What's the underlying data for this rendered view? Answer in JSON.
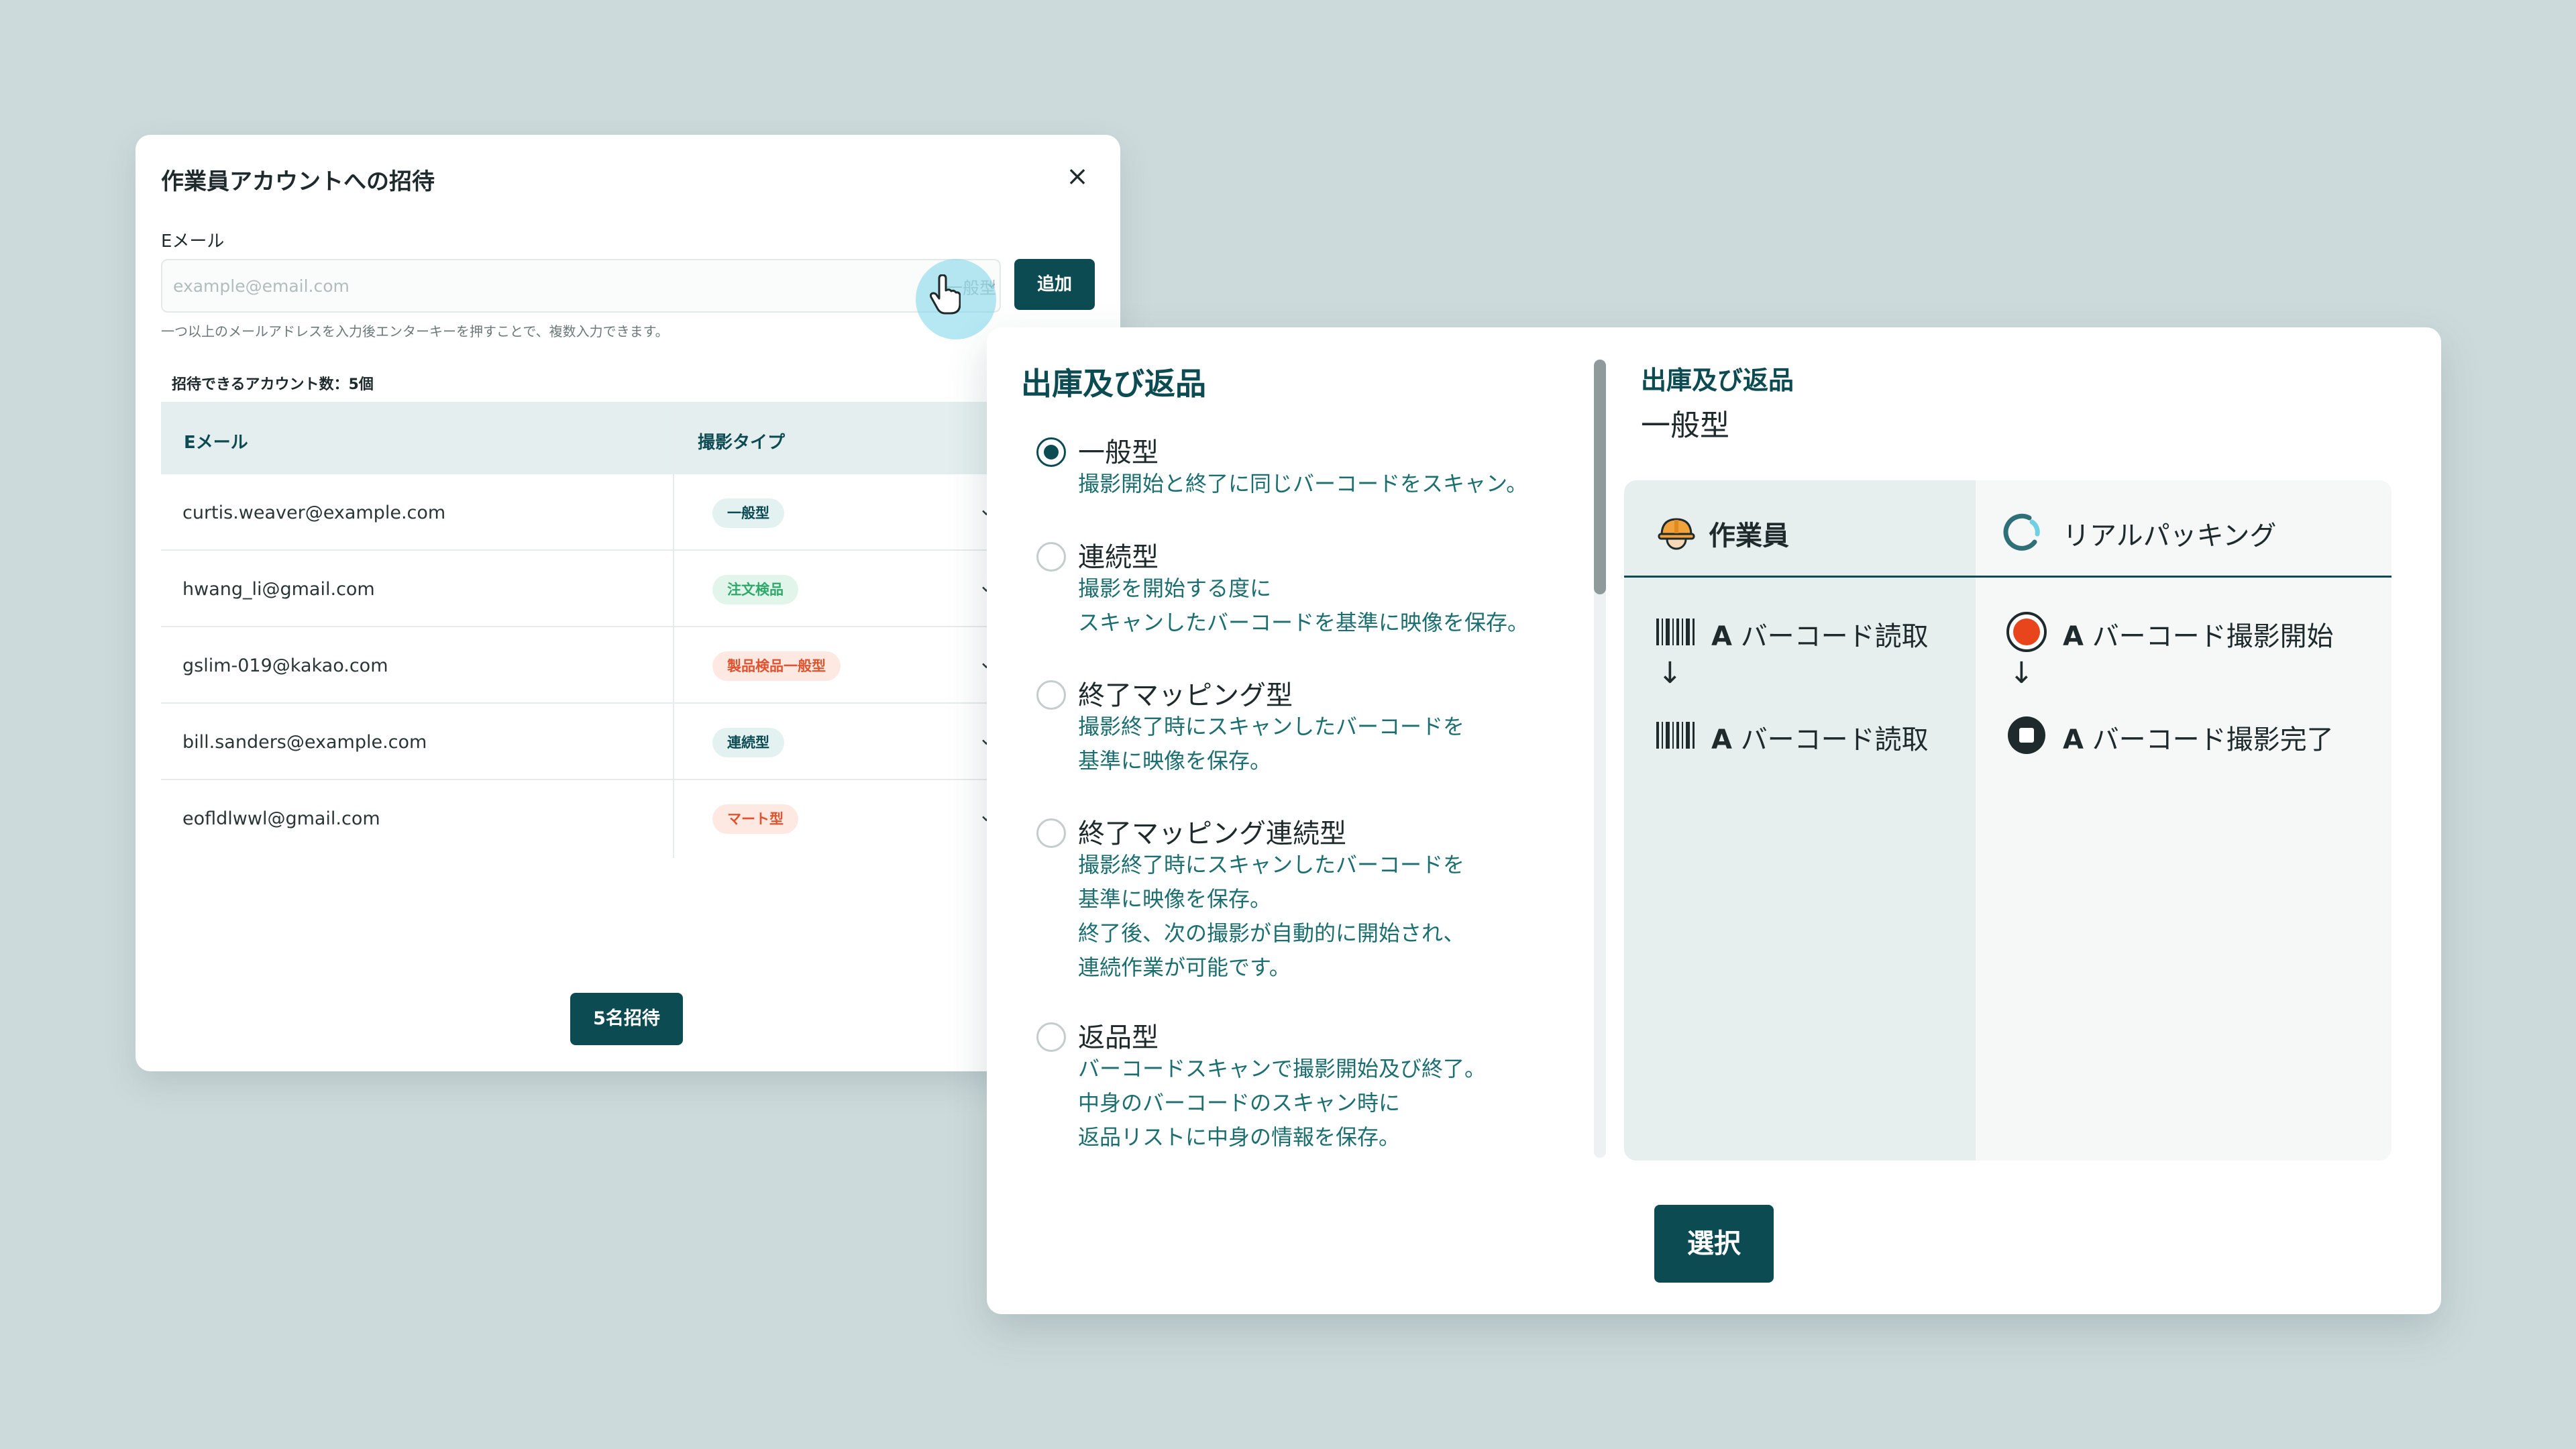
{
  "invite": {
    "title": "作業員アカウントへの招待",
    "email_label": "Eメール",
    "email_placeholder": "example@email.com",
    "field_type": "一般型",
    "add_label": "追加",
    "help_text": "一つ以上のメールアドレスを入力後エンターキーを押すことで、複数入力できます。",
    "count_text": "招待できるアカウント数：5個",
    "col_email": "Eメール",
    "col_type": "撮影タイプ",
    "rows": [
      {
        "email": "curtis.weaver@example.com",
        "type": "一般型",
        "color": "#0d4b52",
        "bg": "#e3f1f1"
      },
      {
        "email": "hwang_li@gmail.com",
        "type": "注文検品",
        "color": "#2fa86b",
        "bg": "#e1f5ea"
      },
      {
        "email": "gslim-019@kakao.com",
        "type": "製品検品一般型",
        "color": "#e0532f",
        "bg": "#fde8e2"
      },
      {
        "email": "bill.sanders@example.com",
        "type": "連続型",
        "color": "#0d4b52",
        "bg": "#e3f1f1"
      },
      {
        "email": "eofldlwwl@gmail.com",
        "type": "マート型",
        "color": "#e0532f",
        "bg": "#fde8e2"
      }
    ],
    "invite_label": "5名招待"
  },
  "panel": {
    "title": "出庫及び返品",
    "options": [
      {
        "name": "一般型",
        "desc": [
          "撮影開始と終了に同じバーコードをスキャン。"
        ],
        "selected": true
      },
      {
        "name": "連続型",
        "desc": [
          "撮影を開始する度に",
          "スキャンしたバーコードを基準に映像を保存。"
        ],
        "selected": false
      },
      {
        "name": "終了マッピング型",
        "desc": [
          "撮影終了時にスキャンしたバーコードを",
          "基準に映像を保存。"
        ],
        "selected": false
      },
      {
        "name": "終了マッピング連続型",
        "desc": [
          "撮影終了時にスキャンしたバーコードを",
          "基準に映像を保存。",
          "終了後、次の撮影が自動的に開始され、",
          "連続作業が可能です。"
        ],
        "selected": false
      },
      {
        "name": "返品型",
        "desc": [
          "バーコードスキャンで撮影開始及び終了。",
          "中身のバーコードのスキャン時に",
          "返品リストに中身の情報を保存。"
        ],
        "selected": false
      }
    ],
    "preview": {
      "group": "出庫及び返品",
      "title": "一般型",
      "worker_label": "作業員",
      "realpacking_label": "リアルパッキング",
      "worker_steps": [
        {
          "mark": "A",
          "text": "バーコード読取"
        },
        {
          "mark": "A",
          "text": "バーコード読取"
        }
      ],
      "rp_steps": [
        {
          "mark": "A",
          "text": "バーコード撮影開始"
        },
        {
          "mark": "A",
          "text": "バーコード撮影完了"
        }
      ],
      "arrow": "↓"
    },
    "select_label": "選択"
  },
  "colors": {
    "accent": "#0d4b52",
    "desc": "#1c6f70",
    "record": "#e8451c"
  }
}
